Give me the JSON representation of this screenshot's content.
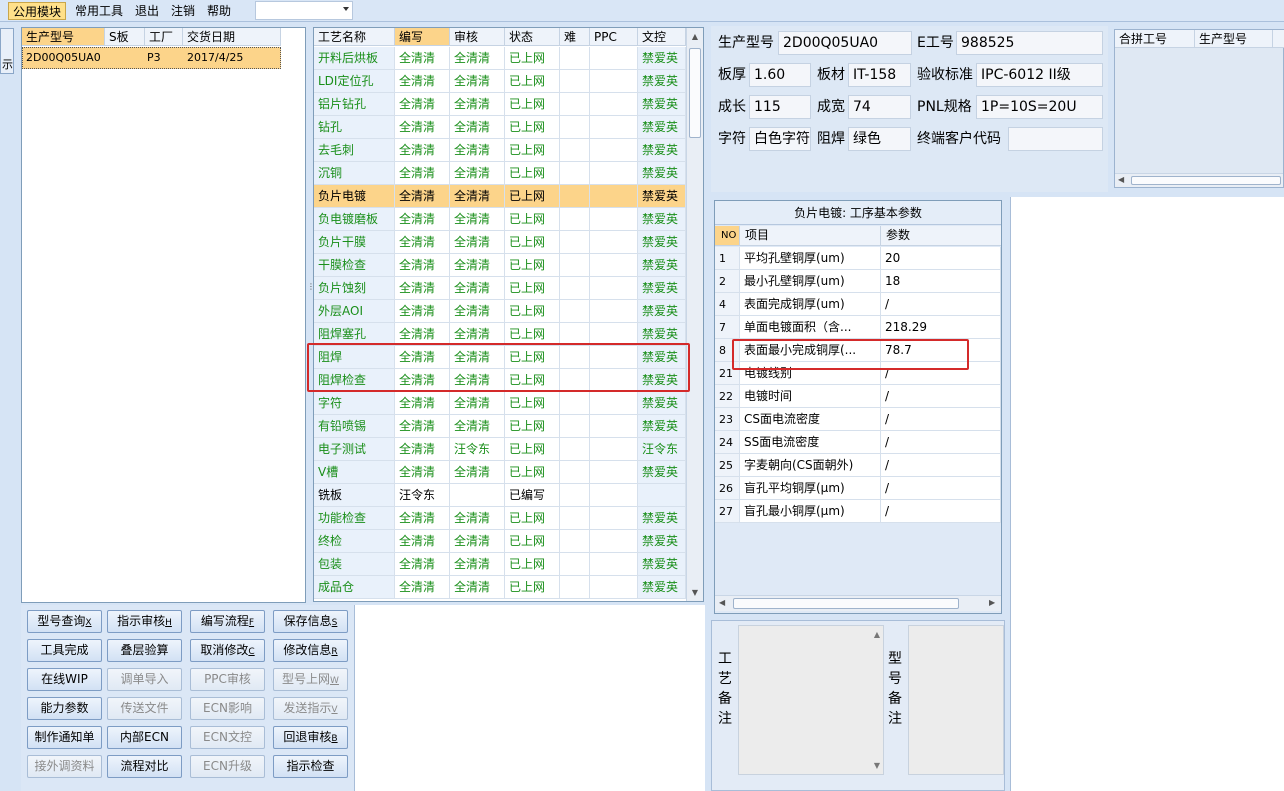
{
  "menu": {
    "items": [
      "公用模块",
      "常用工具",
      "退出",
      "注销",
      "帮助"
    ],
    "active_index": 0
  },
  "left_tab": {
    "label": "示"
  },
  "product_list": {
    "columns": [
      "生产型号",
      "S板",
      "工厂",
      "交货日期"
    ],
    "rows": [
      {
        "model": "2D00Q05UA0",
        "s_board": "",
        "factory": "P3",
        "date": "2017/4/25"
      }
    ]
  },
  "process_grid": {
    "columns": [
      "工艺名称",
      "编写",
      "审核",
      "状态",
      "难",
      "PPC",
      "文控"
    ],
    "selected_row": 6,
    "rows": [
      {
        "name": "开料后烘板",
        "write": "全清清",
        "review": "全清清",
        "status": "已上网",
        "doc": "禁爱英",
        "green": true
      },
      {
        "name": "LDI定位孔",
        "write": "全清清",
        "review": "全清清",
        "status": "已上网",
        "doc": "禁爱英",
        "green": true
      },
      {
        "name": "铝片钻孔",
        "write": "全清清",
        "review": "全清清",
        "status": "已上网",
        "doc": "禁爱英",
        "green": true
      },
      {
        "name": "钻孔",
        "write": "全清清",
        "review": "全清清",
        "status": "已上网",
        "doc": "禁爱英",
        "green": true
      },
      {
        "name": "去毛刺",
        "write": "全清清",
        "review": "全清清",
        "status": "已上网",
        "doc": "禁爱英",
        "green": true
      },
      {
        "name": "沉铜",
        "write": "全清清",
        "review": "全清清",
        "status": "已上网",
        "doc": "禁爱英",
        "green": true
      },
      {
        "name": "负片电镀",
        "write": "全清清",
        "review": "全清清",
        "status": "已上网",
        "doc": "禁爱英",
        "green": false
      },
      {
        "name": "负电镀磨板",
        "write": "全清清",
        "review": "全清清",
        "status": "已上网",
        "doc": "禁爱英",
        "green": true
      },
      {
        "name": "负片干膜",
        "write": "全清清",
        "review": "全清清",
        "status": "已上网",
        "doc": "禁爱英",
        "green": true
      },
      {
        "name": "干膜检查",
        "write": "全清清",
        "review": "全清清",
        "status": "已上网",
        "doc": "禁爱英",
        "green": true
      },
      {
        "name": "负片蚀刻",
        "write": "全清清",
        "review": "全清清",
        "status": "已上网",
        "doc": "禁爱英",
        "green": true
      },
      {
        "name": "外层AOI",
        "write": "全清清",
        "review": "全清清",
        "status": "已上网",
        "doc": "禁爱英",
        "green": true
      },
      {
        "name": "阻焊塞孔",
        "write": "全清清",
        "review": "全清清",
        "status": "已上网",
        "doc": "禁爱英",
        "green": true
      },
      {
        "name": "阻焊",
        "write": "全清清",
        "review": "全清清",
        "status": "已上网",
        "doc": "禁爱英",
        "green": true
      },
      {
        "name": "阻焊检查",
        "write": "全清清",
        "review": "全清清",
        "status": "已上网",
        "doc": "禁爱英",
        "green": true
      },
      {
        "name": "字符",
        "write": "全清清",
        "review": "全清清",
        "status": "已上网",
        "doc": "禁爱英",
        "green": true
      },
      {
        "name": "有铅喷锡",
        "write": "全清清",
        "review": "全清清",
        "status": "已上网",
        "doc": "禁爱英",
        "green": true
      },
      {
        "name": "电子测试",
        "write": "全清清",
        "review": "汪令东",
        "status": "已上网",
        "doc": "汪令东",
        "green": true
      },
      {
        "name": "V槽",
        "write": "全清清",
        "review": "全清清",
        "status": "已上网",
        "doc": "禁爱英",
        "green": true
      },
      {
        "name": "铣板",
        "write": "汪令东",
        "review": "",
        "status": "已编写",
        "doc": "",
        "green": false
      },
      {
        "name": "功能检查",
        "write": "全清清",
        "review": "全清清",
        "status": "已上网",
        "doc": "禁爱英",
        "green": true
      },
      {
        "name": "终检",
        "write": "全清清",
        "review": "全清清",
        "status": "已上网",
        "doc": "禁爱英",
        "green": true
      },
      {
        "name": "包装",
        "write": "全清清",
        "review": "全清清",
        "status": "已上网",
        "doc": "禁爱英",
        "green": true
      },
      {
        "name": "成品仓",
        "write": "全清清",
        "review": "全清清",
        "status": "已上网",
        "doc": "禁爱英",
        "green": true
      }
    ]
  },
  "info": {
    "model_label": "生产型号",
    "model_value": "2D00Q05UA0",
    "e_label": "E工号",
    "e_value": "988525",
    "thickness_label": "板厚",
    "thickness_value": "1.60",
    "material_label": "板材",
    "material_value": "IT-158",
    "standard_label": "验收标准",
    "standard_value": "IPC-6012 II级",
    "length_label": "成长",
    "length_value": "115",
    "width_label": "成宽",
    "width_value": "74",
    "pnl_label": "PNL规格",
    "pnl_value": "1P=10S=20U",
    "char_label": "字符",
    "char_value": "白色字符",
    "mask_label": "阻焊",
    "mask_value": "绿色",
    "customer_label": "终端客户代码",
    "customer_value": ""
  },
  "combined": {
    "columns": [
      "合拼工号",
      "生产型号"
    ]
  },
  "params": {
    "title": "负片电镀: 工序基本参数",
    "columns": [
      "NO",
      "项目",
      "参数"
    ],
    "rows": [
      {
        "no": "1",
        "item": "平均孔壁铜厚(um)",
        "value": "20"
      },
      {
        "no": "2",
        "item": "最小孔壁铜厚(um)",
        "value": "18"
      },
      {
        "no": "4",
        "item": "表面完成铜厚(um)",
        "value": "/"
      },
      {
        "no": "7",
        "item": "单面电镀面积（含...",
        "value": "218.29"
      },
      {
        "no": "8",
        "item": "表面最小完成铜厚(...",
        "value": "78.7"
      },
      {
        "no": "21",
        "item": "电镀线别",
        "value": "/"
      },
      {
        "no": "22",
        "item": "电镀时间",
        "value": "/"
      },
      {
        "no": "23",
        "item": "CS面电流密度",
        "value": "/"
      },
      {
        "no": "24",
        "item": "SS面电流密度",
        "value": "/"
      },
      {
        "no": "25",
        "item": "字麦朝向(CS面朝外)",
        "value": "/"
      },
      {
        "no": "26",
        "item": "盲孔平均铜厚(μm)",
        "value": "/"
      },
      {
        "no": "27",
        "item": "盲孔最小铜厚(μm)",
        "value": "/"
      }
    ]
  },
  "buttons": [
    [
      {
        "label": "型号查询",
        "key": "X",
        "enabled": true
      },
      {
        "label": "指示审核",
        "key": "H",
        "enabled": true
      },
      {
        "label": "编写流程",
        "key": "F",
        "enabled": true
      },
      {
        "label": "保存信息",
        "key": "S",
        "enabled": true
      }
    ],
    [
      {
        "label": "工具完成",
        "key": "",
        "enabled": true
      },
      {
        "label": "叠层验算",
        "key": "",
        "enabled": true
      },
      {
        "label": "取消修改",
        "key": "C",
        "enabled": true
      },
      {
        "label": "修改信息",
        "key": "R",
        "enabled": true
      }
    ],
    [
      {
        "label": "在线WIP",
        "key": "",
        "enabled": true
      },
      {
        "label": "调单导入",
        "key": "",
        "enabled": false
      },
      {
        "label": "PPC审核",
        "key": "",
        "enabled": false
      },
      {
        "label": "型号上网",
        "key": "W",
        "enabled": false
      }
    ],
    [
      {
        "label": "能力参数",
        "key": "",
        "enabled": true
      },
      {
        "label": "传送文件",
        "key": "",
        "enabled": false
      },
      {
        "label": "ECN影响",
        "key": "",
        "enabled": false
      },
      {
        "label": "发送指示",
        "key": "V",
        "enabled": false
      }
    ],
    [
      {
        "label": "制作通知单",
        "key": "",
        "enabled": true
      },
      {
        "label": "内部ECN",
        "key": "",
        "enabled": true
      },
      {
        "label": "ECN文控",
        "key": "",
        "enabled": false
      },
      {
        "label": "回退审核",
        "key": "B",
        "enabled": true
      }
    ],
    [
      {
        "label": "接外调资料",
        "key": "",
        "enabled": false
      },
      {
        "label": "流程对比",
        "key": "",
        "enabled": true
      },
      {
        "label": "ECN升级",
        "key": "",
        "enabled": false
      },
      {
        "label": "指示检查",
        "key": "",
        "enabled": true
      }
    ]
  ],
  "remarks": {
    "process_label": "工艺备注",
    "model_label": "型号备注"
  },
  "colors": {
    "highlight": "#fcd48a",
    "status_green": "#1a8f1a",
    "annotation_red": "#d42a2a"
  }
}
